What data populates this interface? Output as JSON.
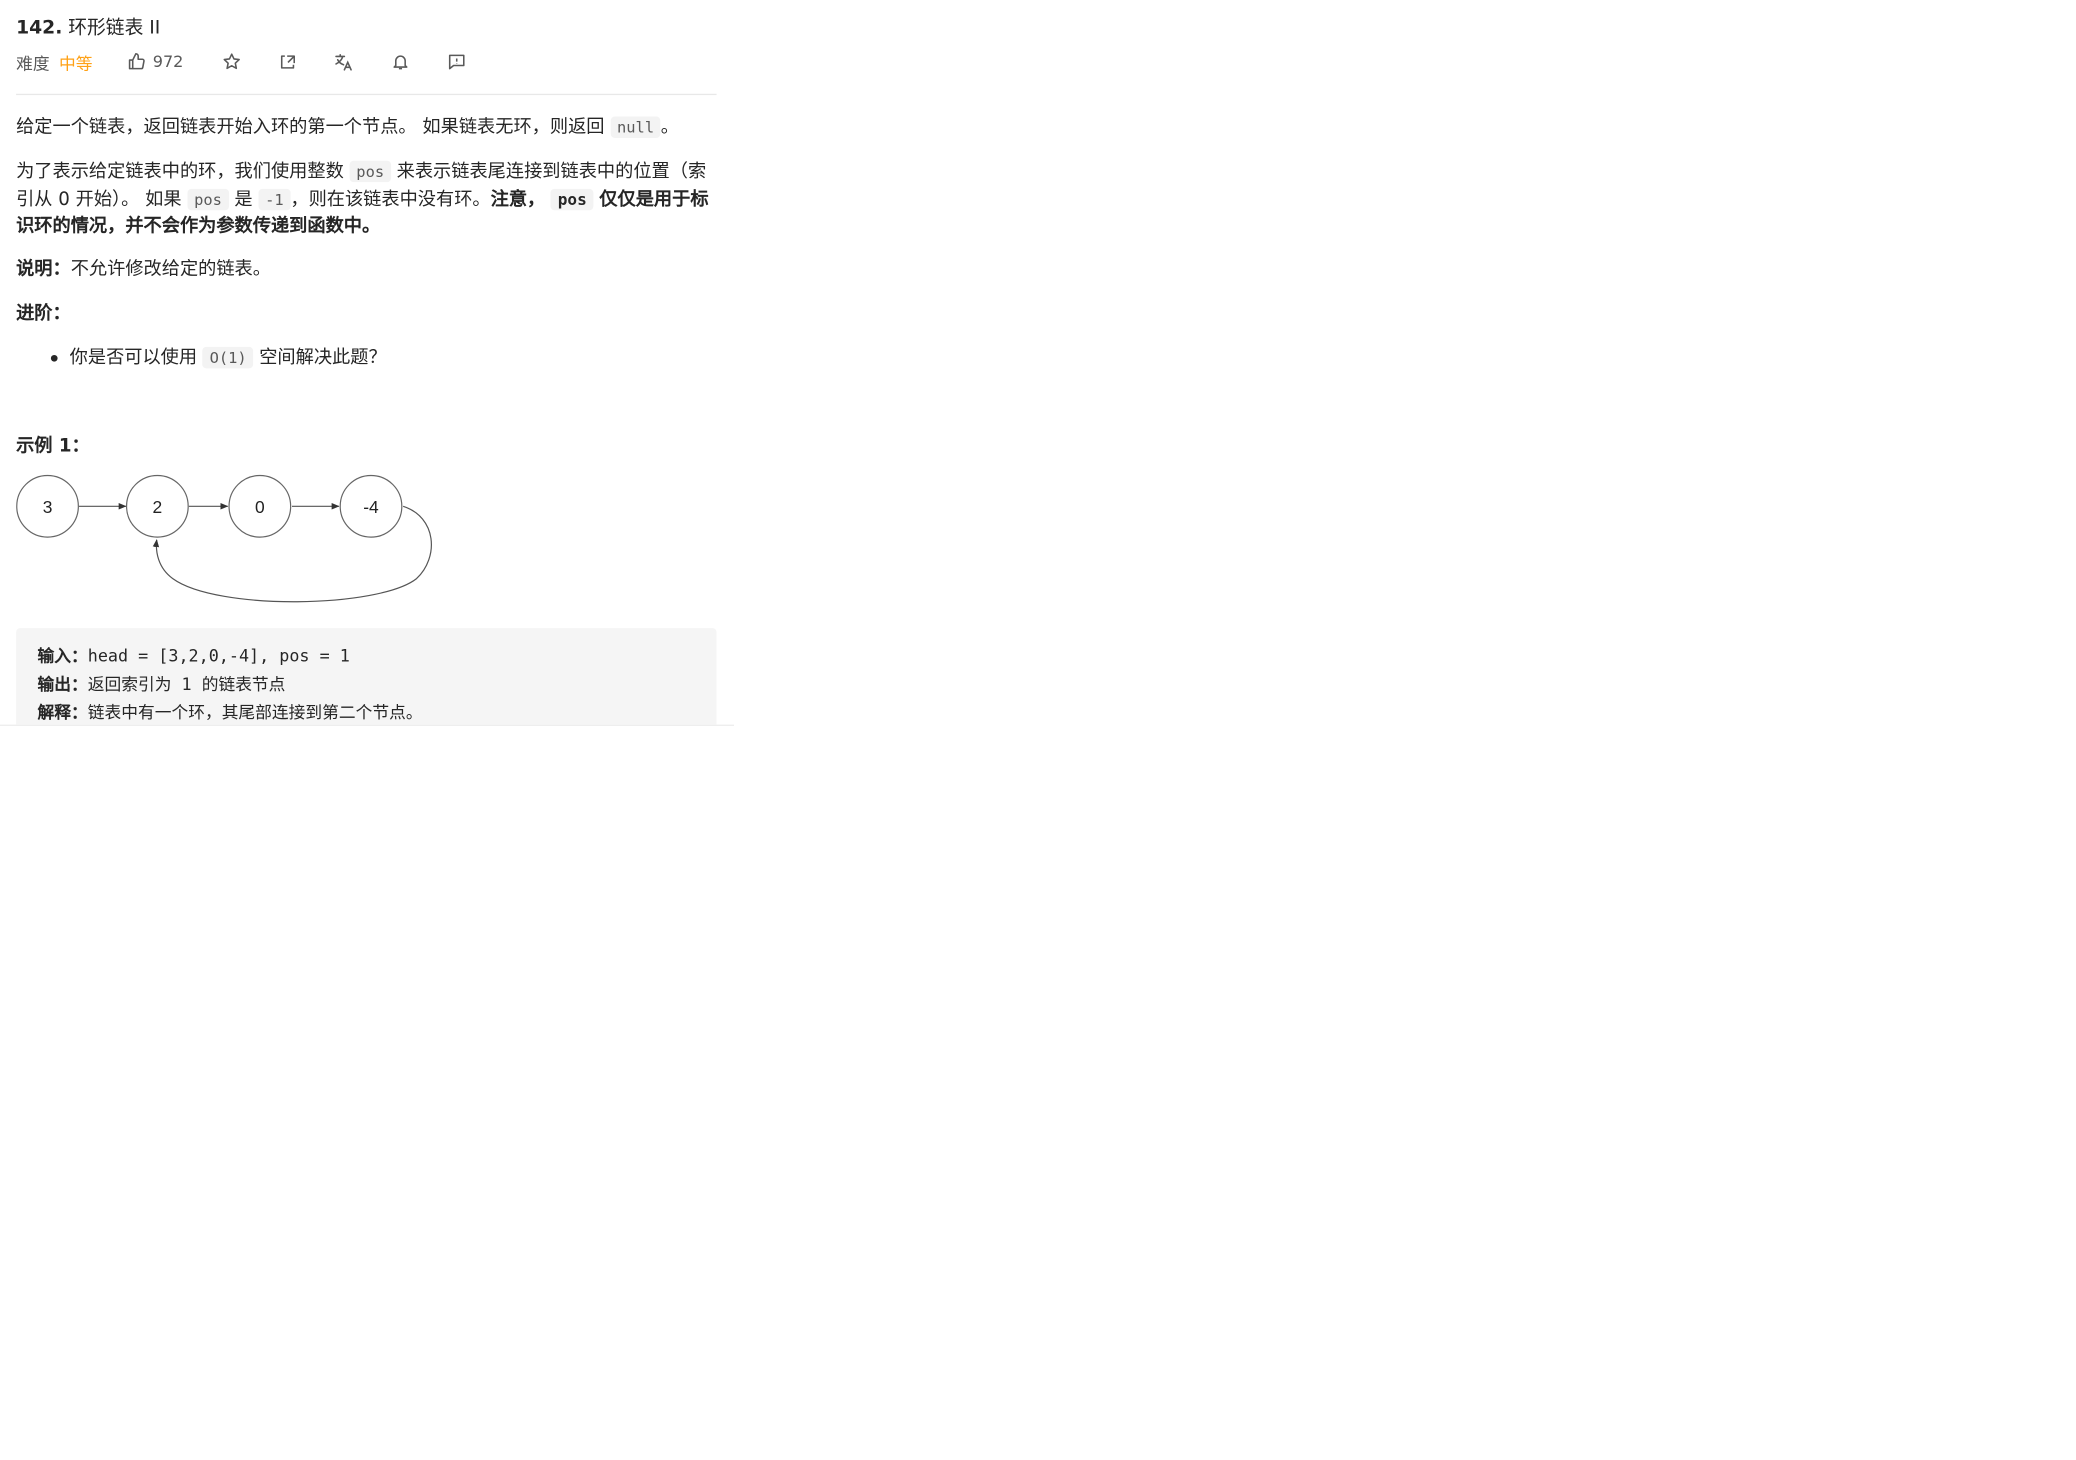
{
  "problem": {
    "number": "142.",
    "title": "环形链表 II",
    "difficulty_label": "难度",
    "difficulty": "中等",
    "likes": "972"
  },
  "icons": [
    "thumbs-up-icon",
    "star-icon",
    "share-icon",
    "translate-icon",
    "bell-icon",
    "feedback-icon"
  ],
  "colors": {
    "difficulty_medium": "#ffa116",
    "text": "#262626",
    "code_bg": "#f3f3f3"
  },
  "description": {
    "p1_text": "给定一个链表，返回链表开始入环的第一个节点。 如果链表无环，则返回",
    "p1_code": "null",
    "p1_end": "。",
    "p2_a": "为了表示给定链表中的环，我们使用整数",
    "p2_code1": "pos",
    "p2_b": "来表示链表尾连接到链表中的位置（索引从 0 开始）。 如果",
    "p2_code2": "pos",
    "p2_c": "是",
    "p2_code3": "-1",
    "p2_d": "，则在该链表中没有环。",
    "p2_bold1": "注意，",
    "p2_code4": "pos",
    "p2_bold2": "仅仅是用于标识环的情况，并不会作为参数传递到函数中。",
    "note_label": "说明：",
    "note_text": "不允许修改给定的链表。",
    "advanced_label": "进阶：",
    "bullet_a": "你是否可以使用",
    "bullet_code": "O(1)",
    "bullet_b": "空间解决此题？"
  },
  "example": {
    "heading": "示例 1：",
    "nodes": [
      "3",
      "2",
      "0",
      "-4"
    ],
    "input_label": "输入：",
    "input_value": "head = [3,2,0,-4], pos = 1",
    "output_label": "输出：",
    "output_value": "返回索引为 1 的链表节点",
    "explain_label": "解释：",
    "explain_value": "链表中有一个环，其尾部连接到第二个节点。"
  }
}
